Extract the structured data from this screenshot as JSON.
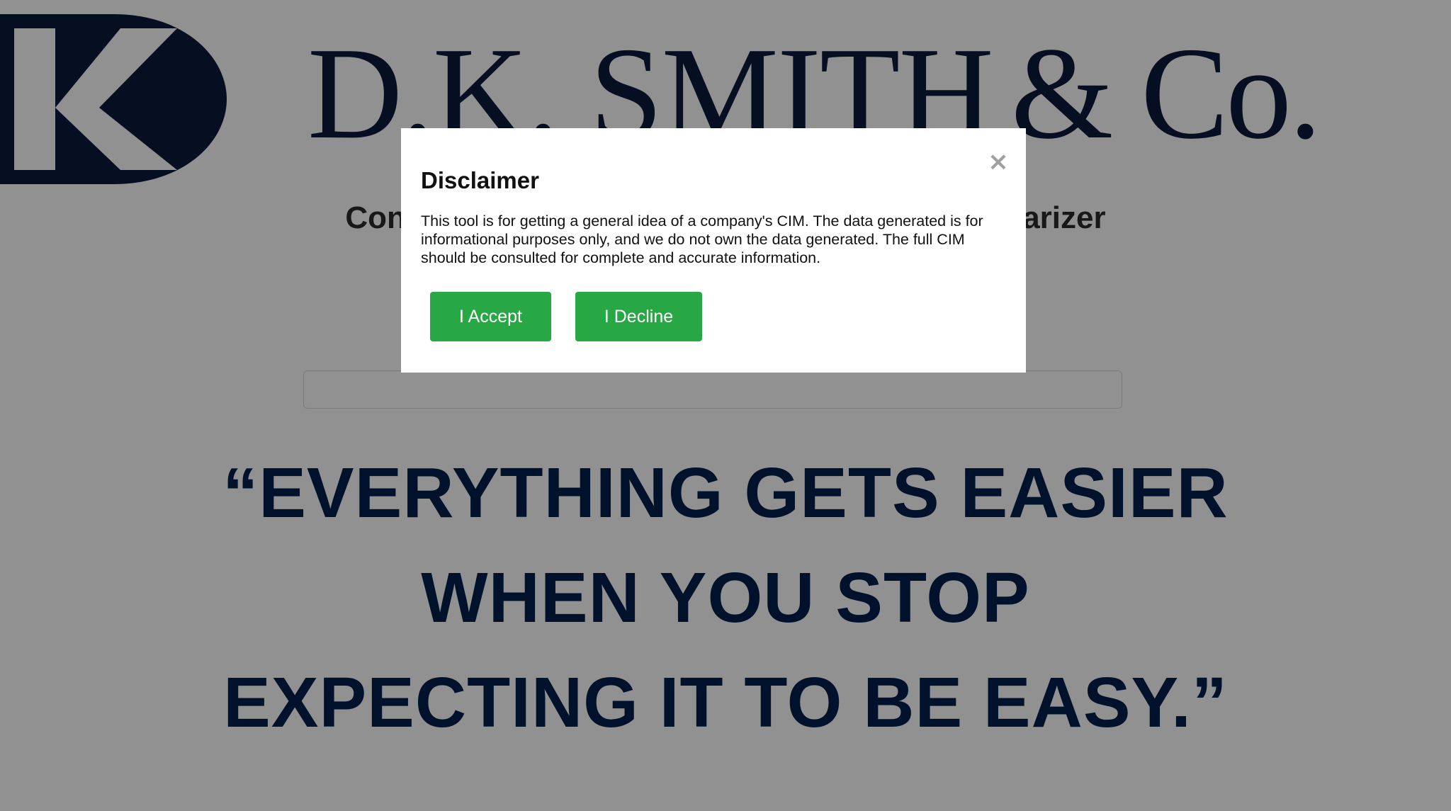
{
  "brand": {
    "logo_icon": "dk-monogram-logo",
    "name_main": "D.K. SMITH",
    "name_co": "& Co.",
    "color": "#0b1a3d"
  },
  "page": {
    "subtitle": "Confidential Information Memorandum Summarizer",
    "input": {
      "value": "",
      "placeholder": ""
    },
    "quote_lines": [
      "“EVERYTHING GETS EASIER",
      "WHEN YOU STOP",
      "EXPECTING IT TO BE EASY.”"
    ],
    "quote_color": "#00214d"
  },
  "modal": {
    "title": "Disclaimer",
    "body": "This tool is for getting a general idea of a company's CIM. The data generated is for informational purposes only, and we do not own the data generated. The full CIM should be consulted for complete and accurate information.",
    "close_icon": "close-icon",
    "close_glyph": "×",
    "accept_label": "I Accept",
    "decline_label": "I Decline",
    "button_color": "#28a745"
  }
}
